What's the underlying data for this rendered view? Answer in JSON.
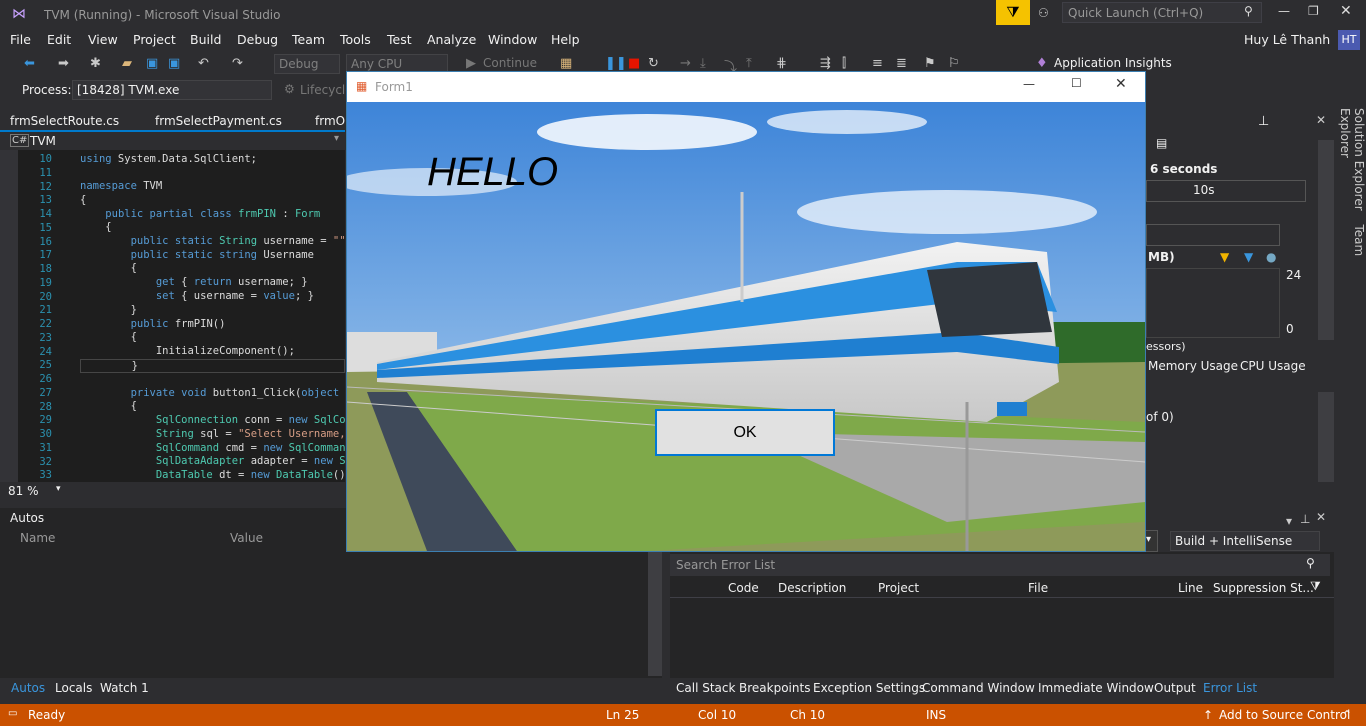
{
  "window": {
    "title": "TVM (Running) - Microsoft Visual Studio",
    "quick_launch_placeholder": "Quick Launch (Ctrl+Q)",
    "user": "Huy Lê Thanh",
    "user_initials": "HT"
  },
  "menu": [
    "File",
    "Edit",
    "View",
    "Project",
    "Build",
    "Debug",
    "Team",
    "Tools",
    "Test",
    "Analyze",
    "Window",
    "Help"
  ],
  "toolbar": {
    "config": "Debug",
    "platform": "Any CPU",
    "continue_label": "Continue",
    "app_insights": "Application Insights"
  },
  "process": {
    "label": "Process:",
    "value": "[18428] TVM.exe",
    "lifecycle": "Lifecycle"
  },
  "doc_tabs": [
    "frmSelectRoute.cs",
    "frmSelectPayment.cs",
    "frmOu"
  ],
  "editor": {
    "project": "TVM",
    "zoom": "81 %",
    "line_numbers": [
      "10",
      "11",
      "12",
      "13",
      "14",
      "15",
      "16",
      "17",
      "18",
      "19",
      "20",
      "21",
      "22",
      "23",
      "24",
      "25",
      "26",
      "27",
      "28",
      "29",
      "30",
      "31",
      "32",
      "33"
    ]
  },
  "form1": {
    "title": "Form1",
    "heading": "HELLO",
    "ok_label": "OK"
  },
  "autos": {
    "title": "Autos",
    "col_name": "Name",
    "col_value": "Value"
  },
  "right_panel": {
    "duration": "6 seconds",
    "timeline": "10s",
    "mb_label": "MB)",
    "val_top": "24",
    "val_bottom": "0",
    "cpu_label": "essors)",
    "tab_memory": "Memory Usage",
    "tab_cpu": "CPU Usage",
    "of_label": "of 0)"
  },
  "error_list": {
    "build_filter": "Build + IntelliSense",
    "search_placeholder": "Search Error List",
    "columns": [
      "Code",
      "Description",
      "Project",
      "File",
      "Line",
      "Suppression St..."
    ]
  },
  "bottom_left_tabs": [
    "Autos",
    "Locals",
    "Watch 1"
  ],
  "bottom_right_tabs": [
    "Call Stack",
    "Breakpoints",
    "Exception Settings",
    "Command Window",
    "Immediate Window",
    "Output",
    "Error List"
  ],
  "side_tabs": [
    "Solution Explorer",
    "Team Explorer"
  ],
  "status": {
    "ready": "Ready",
    "ln": "Ln 25",
    "col": "Col 10",
    "ch": "Ch 10",
    "ins": "INS",
    "source_control": "Add to Source Control"
  }
}
